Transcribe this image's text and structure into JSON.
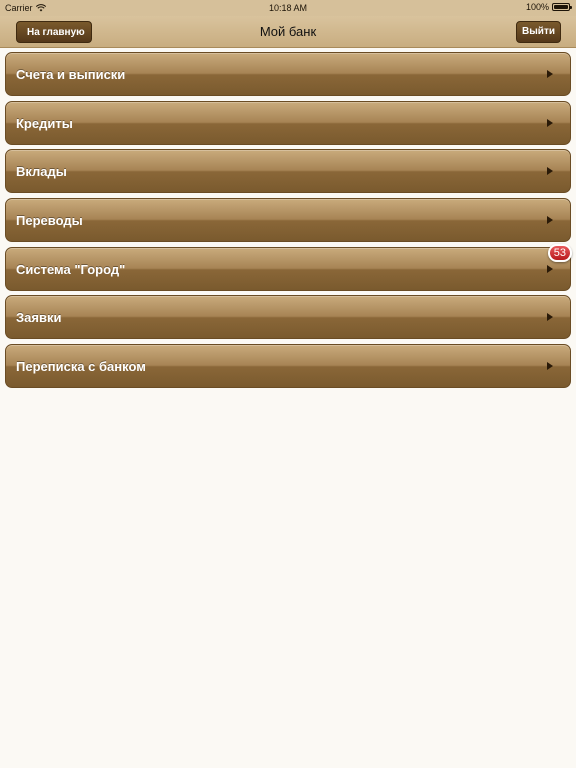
{
  "status_bar": {
    "carrier": "Carrier",
    "time": "10:18 AM",
    "battery": "100%",
    "battery_level": 1.0
  },
  "nav": {
    "title": "Мой банк",
    "back_label": "На главную",
    "logout_label": "Выйти"
  },
  "menu": {
    "items": [
      {
        "label": "Счета и выписки"
      },
      {
        "label": "Кредиты"
      },
      {
        "label": "Вклады"
      },
      {
        "label": "Переводы"
      },
      {
        "label": "Система \"Город\"",
        "badge": "53"
      },
      {
        "label": "Заявки"
      },
      {
        "label": "Переписка с банком"
      }
    ]
  },
  "colors": {
    "background": "#fbf9f4",
    "bar": "#d6c09a",
    "button_brown": "#5f4220",
    "badge_red": "#c8272a"
  },
  "icons": {
    "wifi": "wifi-icon",
    "battery": "battery-icon",
    "chevron": "chevron-right-icon"
  }
}
